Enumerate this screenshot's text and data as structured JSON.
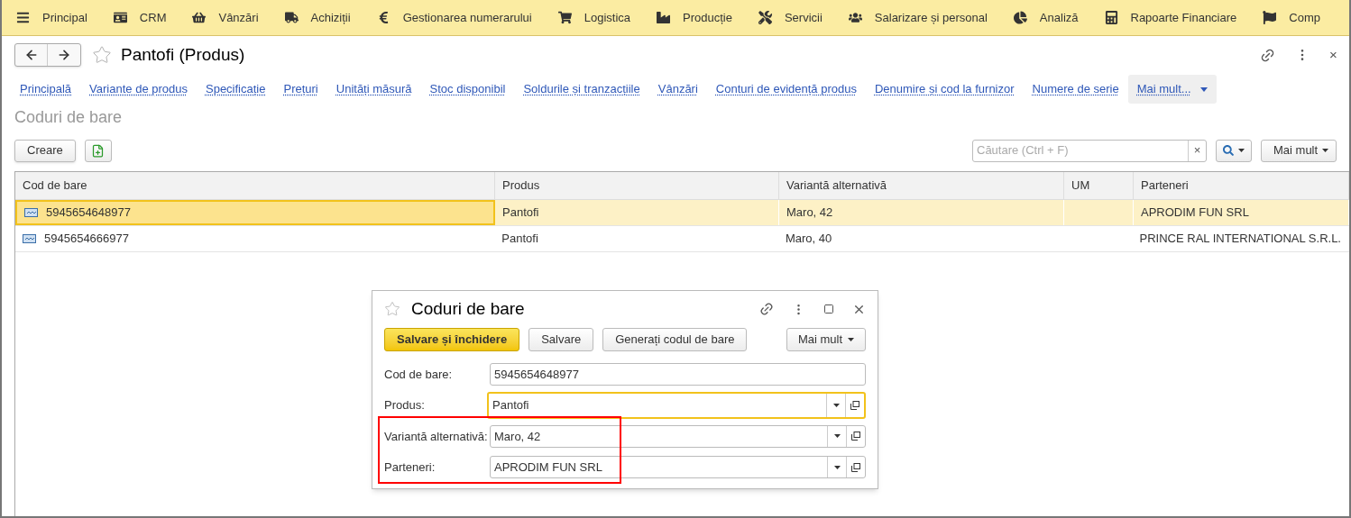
{
  "menu": [
    {
      "label": "Principal"
    },
    {
      "label": "CRM"
    },
    {
      "label": "Vânzări"
    },
    {
      "label": "Achiziții"
    },
    {
      "label": "Gestionarea numerarului"
    },
    {
      "label": "Logistica"
    },
    {
      "label": "Producție"
    },
    {
      "label": "Servicii"
    },
    {
      "label": "Salarizare și personal"
    },
    {
      "label": "Analiză"
    },
    {
      "label": "Rapoarte Financiare"
    },
    {
      "label": "Comp"
    }
  ],
  "form": {
    "title": "Pantofi (Produs)",
    "close": "×"
  },
  "links": [
    "Principală",
    "Variante de produs",
    "Specificație",
    "Prețuri",
    "Unități măsură",
    "Stoc disponibil",
    "Soldurile și tranzacțiile",
    "Vânzări",
    "Conturi de evidență produs",
    "Denumire și cod la furnizor",
    "Numere de serie"
  ],
  "more_link": "Mai mult...",
  "section_title": "Coduri de bare",
  "toolbar": {
    "create": "Creare",
    "search_placeholder": "Căutare (Ctrl + F)",
    "clear": "×",
    "more": "Mai mult"
  },
  "table": {
    "columns": [
      "Cod de bare",
      "Produs",
      "Variantă alternativă",
      "UM",
      "Parteneri"
    ],
    "rows": [
      {
        "selected": true,
        "cells": [
          "5945654648977",
          "Pantofi",
          "Maro, 42",
          "",
          "APRODIM FUN SRL"
        ]
      },
      {
        "selected": false,
        "cells": [
          "5945654666977",
          "Pantofi",
          "Maro, 40",
          "",
          "PRINCE RAL INTERNATIONAL S.R.L."
        ]
      }
    ]
  },
  "dialog": {
    "title": "Coduri de bare",
    "buttons": [
      {
        "kind": "primary",
        "label": "Salvare și închidere"
      },
      {
        "kind": "normal",
        "label": "Salvare"
      },
      {
        "kind": "normal",
        "label": "Generați codul de bare"
      }
    ],
    "more": "Mai mult",
    "fields": [
      {
        "kind": "text",
        "label": "Cod de bare:",
        "value": "5945654648977",
        "focused": false
      },
      {
        "kind": "select",
        "label": "Produs:",
        "value": "Pantofi",
        "focused": true
      },
      {
        "kind": "select",
        "label": "Variantă alternativă:",
        "value": "Maro, 42",
        "focused": false
      },
      {
        "kind": "select",
        "label": "Parteneri:",
        "value": "APRODIM FUN SRL",
        "focused": false
      }
    ]
  }
}
